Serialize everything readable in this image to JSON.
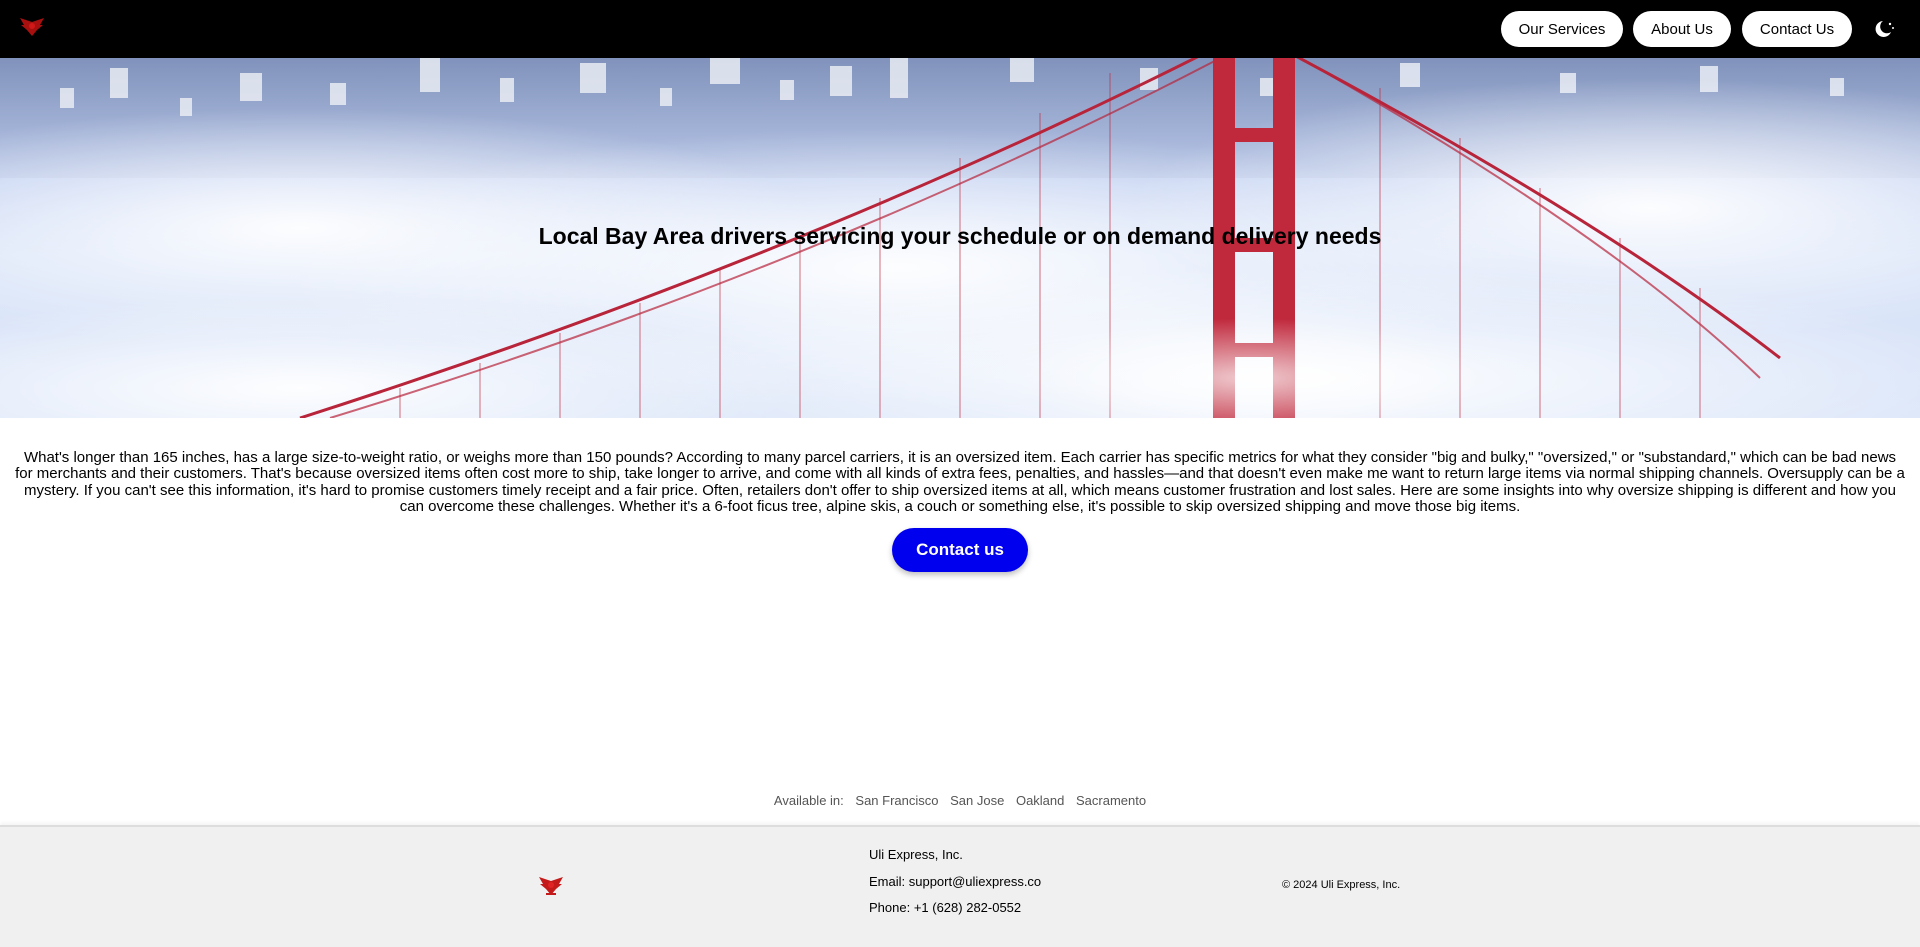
{
  "nav": {
    "logo_icon": "eagle-logo-icon",
    "services_label": "Our Services",
    "about_label": "About Us",
    "contact_label": "Contact Us",
    "theme_icon": "moon-icon"
  },
  "hero": {
    "title": "Local Bay Area drivers servicing your schedule or on demand delivery needs"
  },
  "main": {
    "paragraph": "What's longer than 165 inches, has a large size-to-weight ratio, or weighs more than 150 pounds? According to many parcel carriers, it is an oversized item. Each carrier has specific metrics for what they consider \"big and bulky,\" \"oversized,\" or \"substandard,\" which can be bad news for merchants and their customers. That's because oversized items often cost more to ship, take longer to arrive, and come with all kinds of extra fees, penalties, and hassles—and that doesn't even make me want to return large items via normal shipping channels. Oversupply can be a mystery. If you can't see this information, it's hard to promise customers timely receipt and a fair price. Often, retailers don't offer to ship oversized items at all, which means customer frustration and lost sales. Here are some insights into why oversize shipping is different and how you can overcome these challenges. Whether it's a 6-foot ficus tree, alpine skis, a couch or something else, it's possible to skip oversized shipping and move those big items.",
    "cta_label": "Contact us"
  },
  "availability": {
    "label": "Available in:",
    "cities": [
      "San Francisco",
      "San Jose",
      "Oakland",
      "Sacramento"
    ]
  },
  "footer": {
    "company": "Uli Express, Inc.",
    "email": "Email: support@uliexpress.co",
    "phone": "Phone: +1 (628) 282-0552",
    "copyright": "© 2024 Uli Express, Inc."
  },
  "colors": {
    "nav_bg": "#000000",
    "cta_bg": "#0000ee",
    "footer_bg": "#f0f0f0",
    "bridge_red": "#c0283c",
    "sky_fog": "#d4e1f7"
  }
}
